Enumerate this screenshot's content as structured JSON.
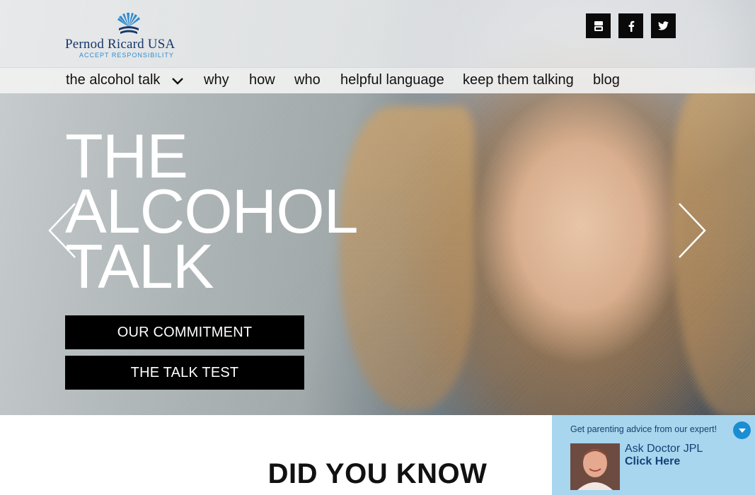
{
  "header": {
    "logo": {
      "brand": "Pernod Ricard USA",
      "tagline": "ACCEPT RESPONSIBILITY",
      "icon": "sunburst-logo-icon"
    },
    "social": [
      {
        "name": "youtube-icon",
        "glyph": "You Tube"
      },
      {
        "name": "facebook-icon",
        "glyph": "f"
      },
      {
        "name": "twitter-icon",
        "glyph": "bird"
      }
    ]
  },
  "nav": {
    "items": [
      {
        "label": "the alcohol talk",
        "has_dropdown": true
      },
      {
        "label": "why"
      },
      {
        "label": "how"
      },
      {
        "label": "who"
      },
      {
        "label": "helpful language"
      },
      {
        "label": "keep them talking"
      },
      {
        "label": "blog"
      }
    ]
  },
  "hero": {
    "title_lines": [
      "THE",
      "ALCOHOL",
      "TALK"
    ],
    "buttons": [
      {
        "label": "OUR COMMITMENT"
      },
      {
        "label": "THE TALK TEST"
      }
    ],
    "prev_icon": "chevron-left-icon",
    "next_icon": "chevron-right-icon"
  },
  "main": {
    "section_title": "DID YOU KNOW"
  },
  "expert_widget": {
    "tagline": "Get parenting advice from our expert!",
    "name": "Ask Doctor JPL",
    "cta": "Click Here",
    "toggle_icon": "chevron-down-icon"
  },
  "colors": {
    "brand_navy": "#17376a",
    "brand_blue": "#2f8bcf",
    "widget_bg": "#a7d6ee",
    "toggle_blue": "#1b8dd3",
    "button_bg": "#000000"
  }
}
